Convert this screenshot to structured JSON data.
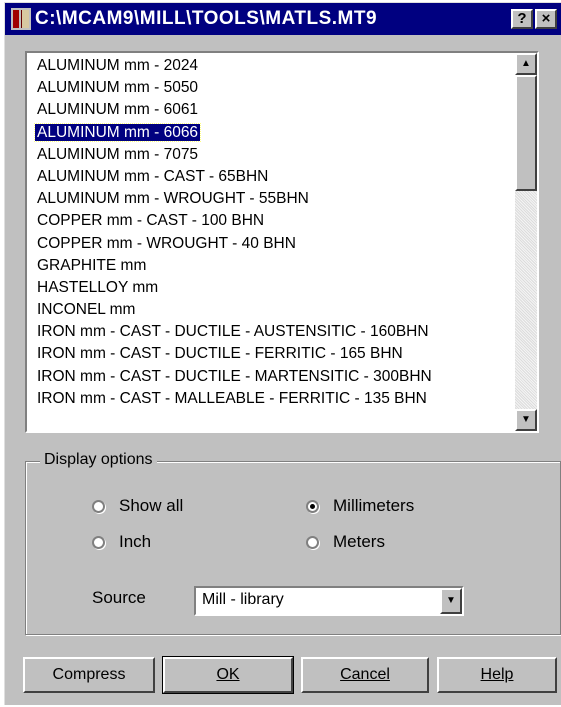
{
  "window": {
    "title": "C:\\MCAM9\\MILL\\TOOLS\\MATLS.MT9",
    "help_button": "?",
    "close_button": "×",
    "app_icon": "mastercam-icon"
  },
  "materials_list": {
    "selected_index": 3,
    "items": [
      "ALUMINUM mm - 2024",
      "ALUMINUM mm - 5050",
      "ALUMINUM mm - 6061",
      "ALUMINUM mm - 6066",
      "ALUMINUM mm - 7075",
      "ALUMINUM mm - CAST - 65BHN",
      "ALUMINUM mm - WROUGHT - 55BHN",
      "COPPER mm - CAST - 100 BHN",
      "COPPER mm - WROUGHT - 40 BHN",
      "GRAPHITE mm",
      "HASTELLOY mm",
      "INCONEL mm",
      "IRON mm - CAST - DUCTILE - AUSTENSITIC - 160BHN",
      "IRON mm - CAST - DUCTILE - FERRITIC - 165 BHN",
      "IRON mm - CAST - DUCTILE - MARTENSITIC - 300BHN",
      "IRON mm - CAST - MALLEABLE - FERRITIC - 135 BHN"
    ],
    "scroll_up_icon": "▲",
    "scroll_down_icon": "▼"
  },
  "display_options": {
    "legend": "Display options",
    "show_all": "Show all",
    "inch": "Inch",
    "millimeters": "Millimeters",
    "meters": "Meters",
    "selected_filter": "Show all",
    "selected_units": "Millimeters",
    "source_label": "Source",
    "source_value": "Mill - library",
    "dropdown_icon": "▼"
  },
  "buttons": {
    "compress": "Compress",
    "ok": "OK",
    "cancel": "Cancel",
    "help": "Help"
  },
  "colors": {
    "titlebar": "#000080",
    "selection": "#000080",
    "face": "#c0c0c0"
  }
}
